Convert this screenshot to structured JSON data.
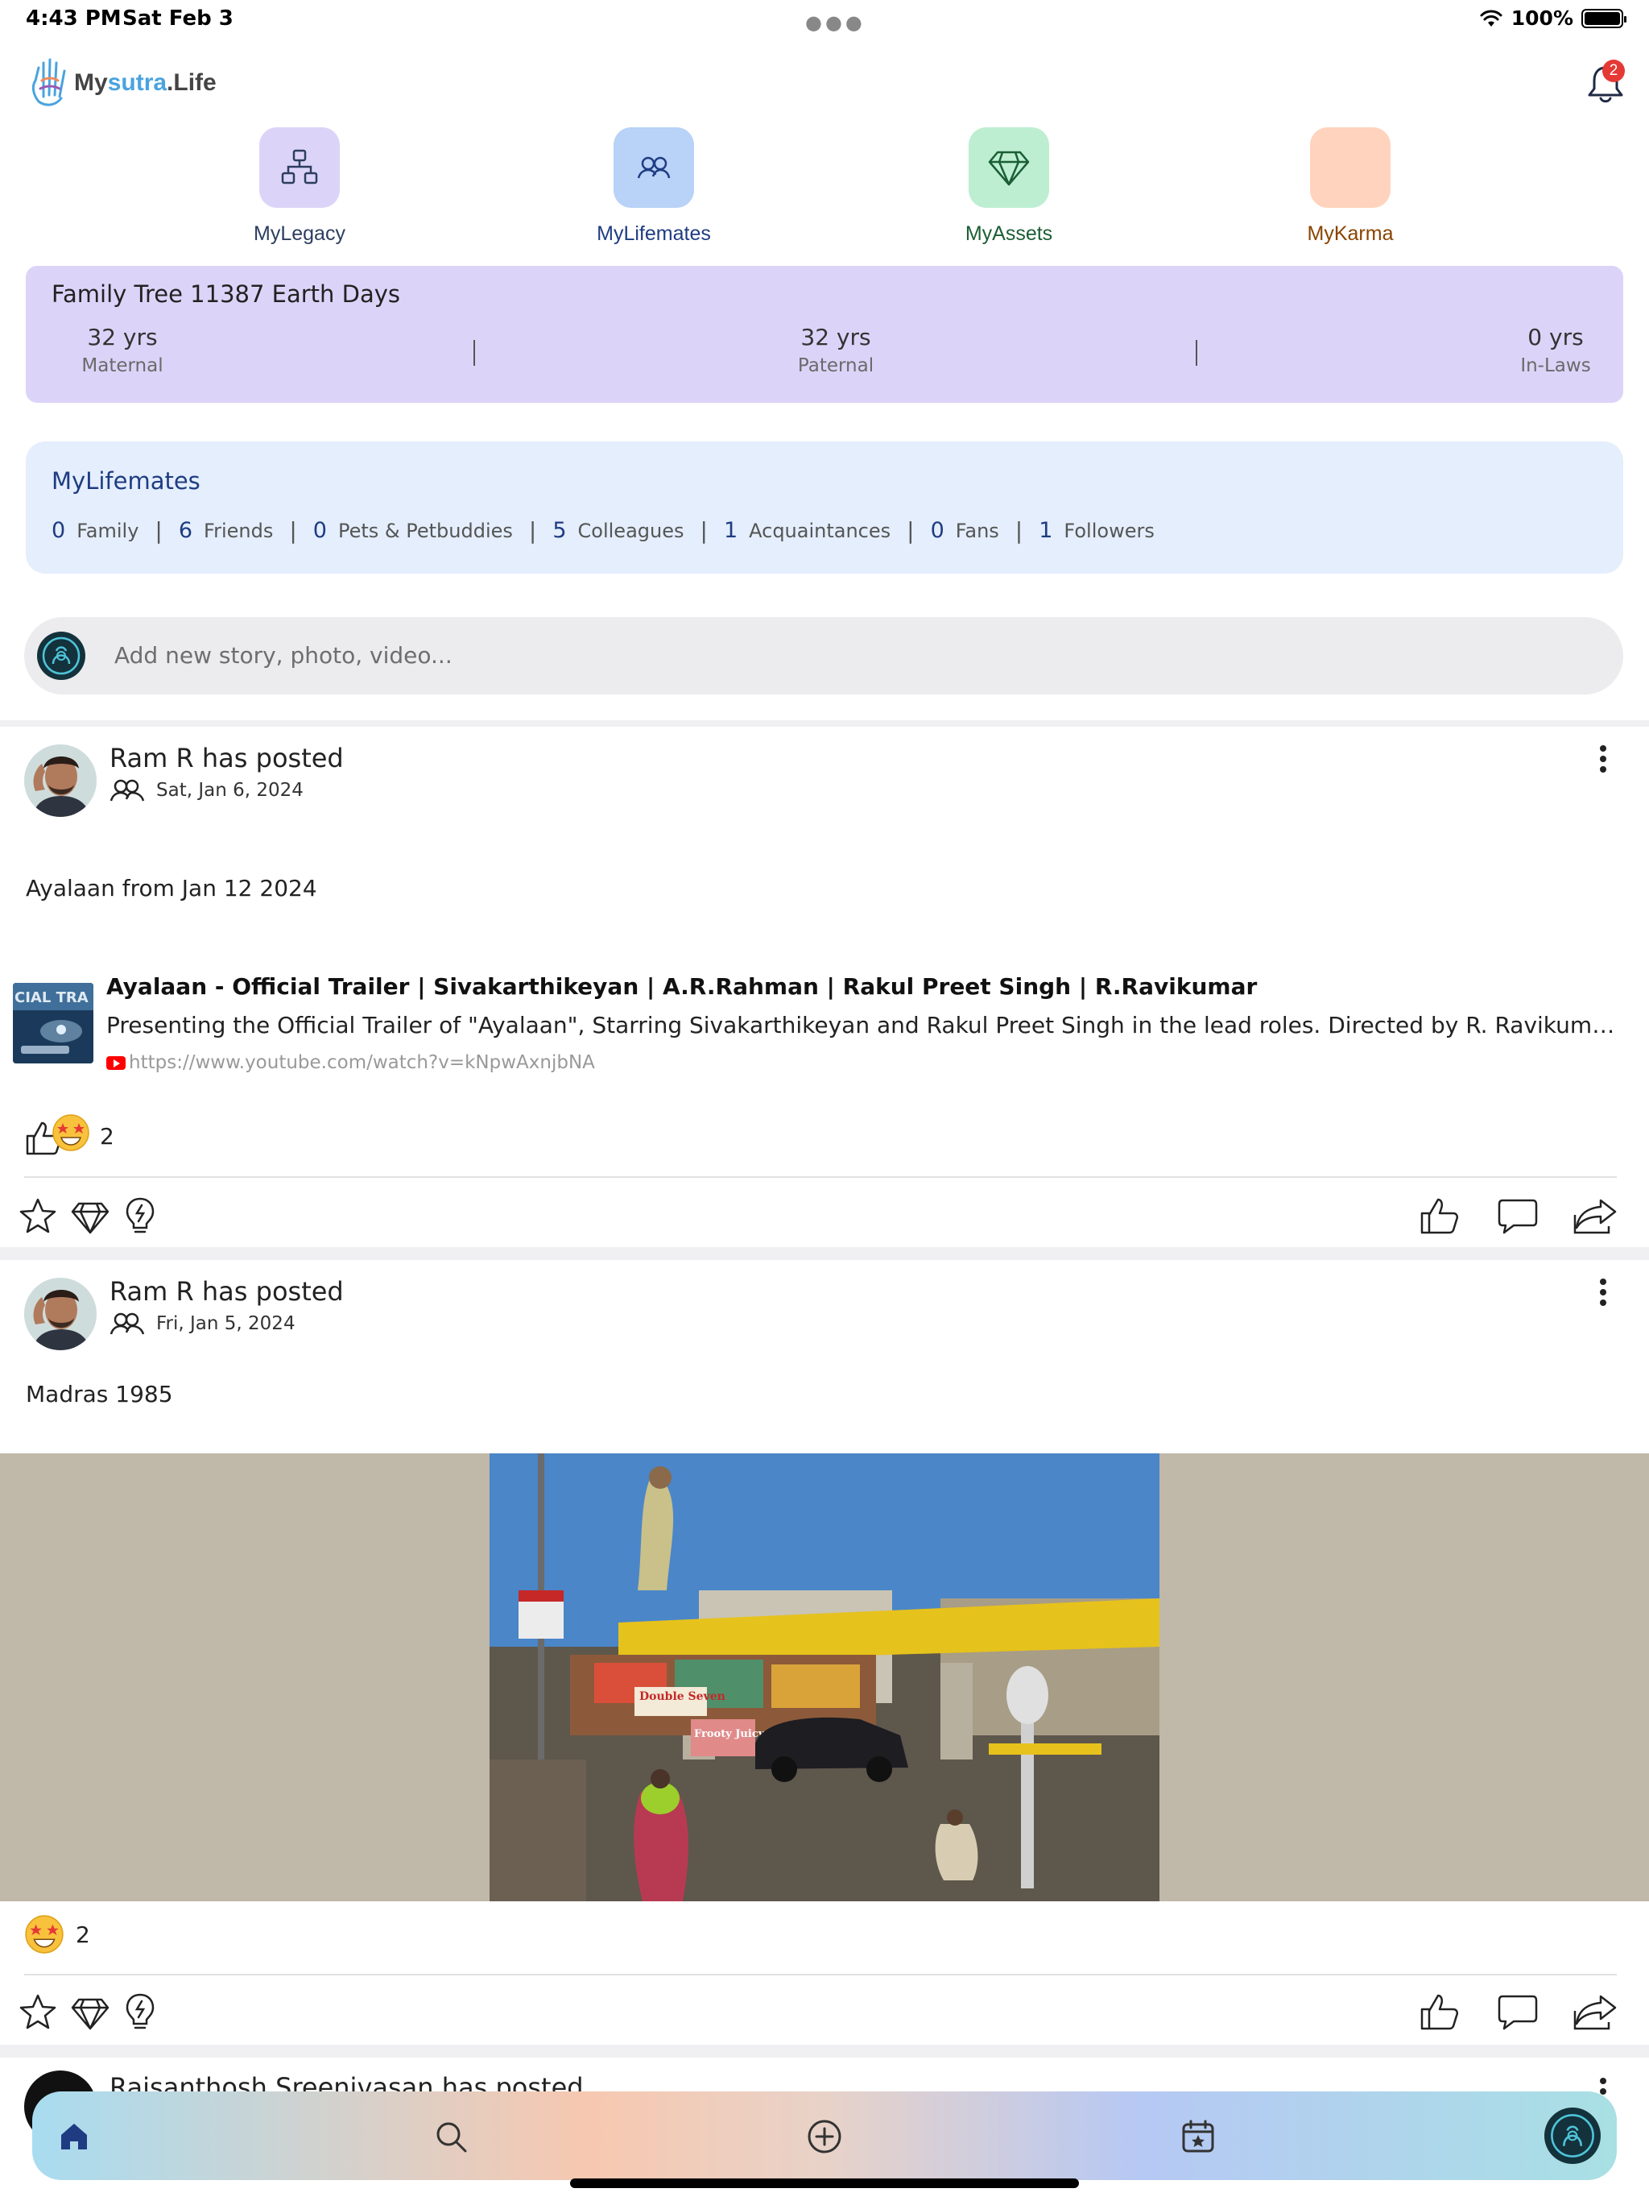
{
  "status_bar": {
    "time": "4:43 PM",
    "date": "Sat Feb 3",
    "battery": "100%"
  },
  "header": {
    "logo_prefix": "My",
    "logo_accent": "sutra",
    "logo_suffix": ".Life",
    "notification_count": "2"
  },
  "nav_tiles": [
    {
      "label": "MyLegacy",
      "icon": "hierarchy-icon",
      "tile_color": "#dcd4f8",
      "label_color": "#2c3e60"
    },
    {
      "label": "MyLifemates",
      "icon": "people-icon",
      "tile_color": "#b8d2f8",
      "label_color": "#1f3c82"
    },
    {
      "label": "MyAssets",
      "icon": "diamond-icon",
      "tile_color": "#bdeed2",
      "label_color": "#1b5e34"
    },
    {
      "label": "MyKarma",
      "icon": "blank-icon",
      "tile_color": "#ffd3bd",
      "label_color": "#8a4300"
    }
  ],
  "family_tree": {
    "title": "Family Tree 11387 Earth Days",
    "stats": [
      {
        "value": "32 yrs",
        "label": "Maternal"
      },
      {
        "value": "32 yrs",
        "label": "Paternal"
      },
      {
        "value": "0 yrs",
        "label": "In-Laws"
      }
    ]
  },
  "lifemates": {
    "title": "MyLifemates",
    "groups": [
      {
        "count": "0",
        "label": "Family"
      },
      {
        "count": "6",
        "label": "Friends"
      },
      {
        "count": "0",
        "label": "Pets & Petbuddies"
      },
      {
        "count": "5",
        "label": "Colleagues"
      },
      {
        "count": "1",
        "label": "Acquaintances"
      },
      {
        "count": "0",
        "label": "Fans"
      },
      {
        "count": "1",
        "label": "Followers"
      }
    ]
  },
  "composer": {
    "placeholder": "Add new story, photo, video..."
  },
  "posts": [
    {
      "author": "Ram R has posted",
      "date": "Sat, Jan 6, 2024",
      "text": "Ayalaan from Jan 12 2024",
      "link": {
        "title": "Ayalaan - Official Trailer | Sivakarthikeyan | A.R.Rahman | Rakul Preet Singh | R.Ravikumar",
        "description": "Presenting the Official Trailer of \"Ayalaan\", Starring Sivakarthikeyan and Rakul Preet Singh in the lead roles. Directed by R. Ravikumar and produced ...",
        "url": "https://www.youtube.com/watch?v=kNpwAxnjbNA",
        "thumb_text": "CIAL TRA"
      },
      "reaction_count": "2"
    },
    {
      "author": "Ram R has posted",
      "date": "Fri, Jan 5, 2024",
      "text": "Madras 1985",
      "photo_signs": [
        "Double Seven",
        "Frooty Juicy"
      ],
      "reaction_count": "2"
    },
    {
      "author": "Rajsanthosh Sreenivasan has posted"
    }
  ],
  "tab_bar": {
    "items": [
      "home-icon",
      "search-icon",
      "add-circle-icon",
      "calendar-star-icon",
      "profile-avatar-icon"
    ],
    "active_color": "#1f3c82"
  }
}
